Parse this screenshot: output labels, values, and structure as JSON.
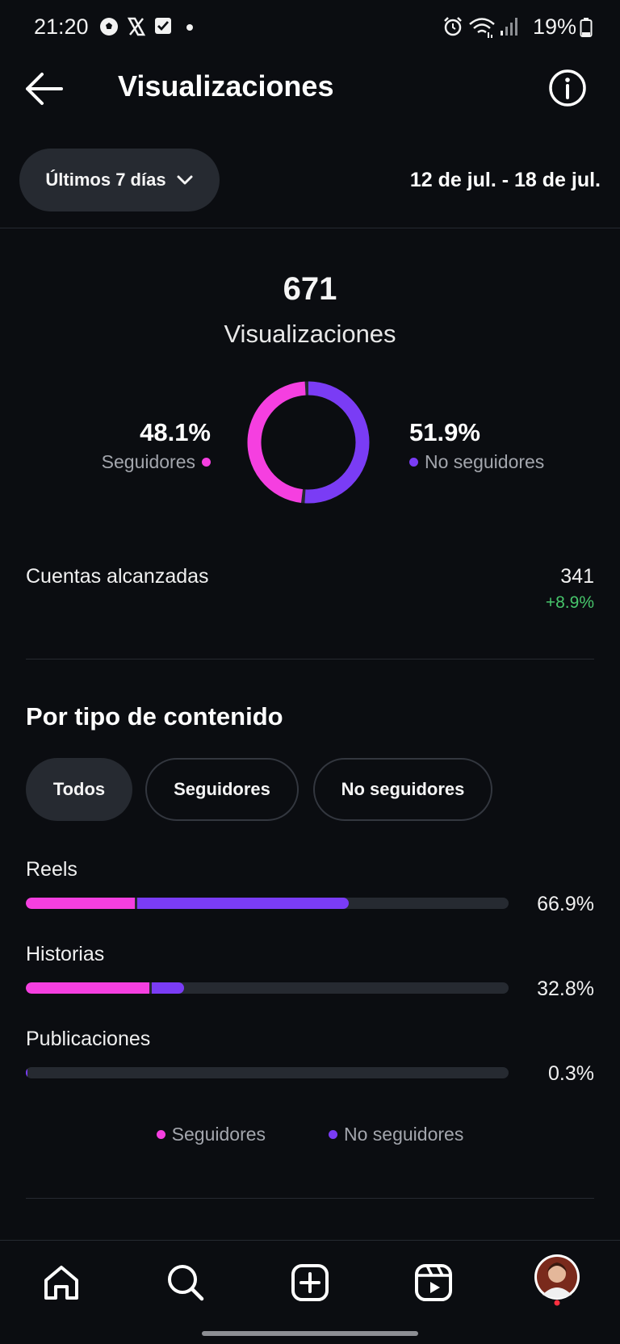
{
  "status_bar": {
    "time": "21:20",
    "battery": "19%",
    "icons": [
      "soccer-ball-icon",
      "x-logo-icon",
      "checkbox-icon",
      "dot-icon",
      "alarm-icon",
      "wifi-icon",
      "signal-icon",
      "battery-icon"
    ]
  },
  "header": {
    "title": "Visualizaciones",
    "back_icon": "arrow-left-icon",
    "info_icon": "info-icon"
  },
  "filter": {
    "range_label": "Últimos 7 días",
    "date_range": "12 de jul. - 18 de jul."
  },
  "summary": {
    "total": "671",
    "total_label": "Visualizaciones",
    "followers_pct": "48.1%",
    "followers_label": "Seguidores",
    "nonfollowers_pct": "51.9%",
    "nonfollowers_label": "No seguidores"
  },
  "reach": {
    "label": "Cuentas alcanzadas",
    "value": "341",
    "change": "+8.9%"
  },
  "content_type": {
    "title": "Por tipo de contenido",
    "chips": [
      {
        "label": "Todos",
        "selected": true
      },
      {
        "label": "Seguidores",
        "selected": false
      },
      {
        "label": "No seguidores",
        "selected": false
      }
    ],
    "rows": [
      {
        "label": "Reels",
        "pct": "66.9%",
        "total": 66.9,
        "followers": 22.6,
        "nonfollowers": 44.3
      },
      {
        "label": "Historias",
        "pct": "32.8%",
        "total": 32.8,
        "followers": 25.6,
        "nonfollowers": 7.2
      },
      {
        "label": "Publicaciones",
        "pct": "0.3%",
        "total": 0.3,
        "followers": 0,
        "nonfollowers": 0.3
      }
    ],
    "legend": {
      "followers": "Seguidores",
      "nonfollowers": "No seguidores"
    }
  },
  "colors": {
    "followers": "#f53fe0",
    "nonfollowers": "#7a3cf5",
    "positive": "#47c56b"
  },
  "bottom_nav": {
    "items": [
      "home-icon",
      "search-icon",
      "create-icon",
      "reels-icon",
      "profile-avatar"
    ]
  }
}
